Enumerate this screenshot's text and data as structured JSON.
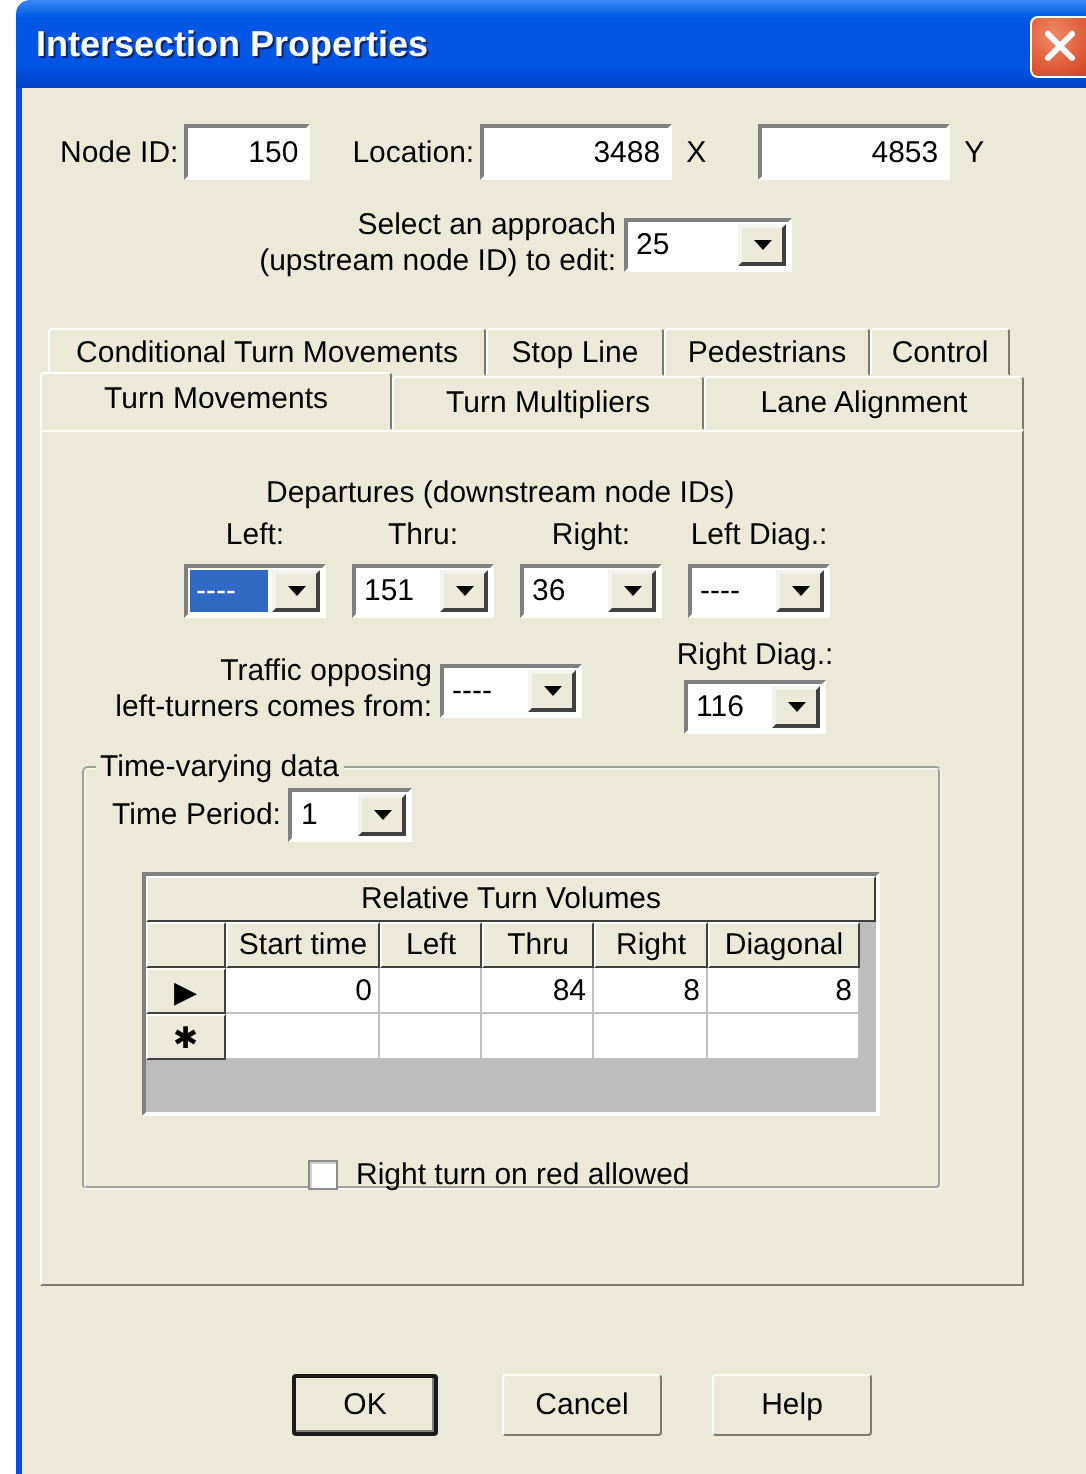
{
  "window": {
    "title": "Intersection Properties"
  },
  "node_id": {
    "label": "Node ID:",
    "value": "150"
  },
  "location": {
    "label": "Location:",
    "x": {
      "value": "3488",
      "unit": "X"
    },
    "y": {
      "value": "4853",
      "unit": "Y"
    }
  },
  "approach": {
    "label_lines": [
      "Select an approach",
      "(upstream node ID) to edit:"
    ],
    "value": "25"
  },
  "tab_rows": [
    [
      {
        "label": "Conditional Turn Movements",
        "selected": false
      },
      {
        "label": "Stop Line",
        "selected": false
      },
      {
        "label": "Pedestrians",
        "selected": false
      },
      {
        "label": "Control",
        "selected": false
      }
    ],
    [
      {
        "label": "Turn Movements",
        "selected": true
      },
      {
        "label": "Turn Multipliers",
        "selected": false
      },
      {
        "label": "Lane Alignment",
        "selected": false
      }
    ]
  ],
  "departures": {
    "title": "Departures (downstream node IDs)",
    "fields": [
      {
        "label": "Left:",
        "value": "----",
        "focused": true
      },
      {
        "label": "Thru:",
        "value": "151",
        "focused": false
      },
      {
        "label": "Right:",
        "value": "36",
        "focused": false
      },
      {
        "label": "Left Diag.:",
        "value": "----",
        "focused": false
      }
    ]
  },
  "opposing": {
    "label_lines": [
      "Traffic opposing",
      "left-turners comes from:"
    ],
    "value": "----"
  },
  "right_diag": {
    "label": "Right Diag.:",
    "value": "116"
  },
  "time_varying": {
    "title": "Time-varying data",
    "time_period": {
      "label": "Time Period:",
      "value": "1"
    },
    "table": {
      "title": "Relative Turn Volumes",
      "columns": [
        "Start time",
        "Left",
        "Thru",
        "Right",
        "Diagonal"
      ],
      "rows": [
        {
          "marker": "▶",
          "cells": [
            "0",
            null,
            "84",
            "8",
            "8"
          ]
        },
        {
          "marker": "✱",
          "cells": [
            null,
            null,
            null,
            null,
            null
          ]
        }
      ]
    },
    "right_turn_on_red": {
      "label": "Right turn on red allowed",
      "checked": false
    }
  },
  "buttons": [
    {
      "label": "OK",
      "default": true
    },
    {
      "label": "Cancel",
      "default": false
    },
    {
      "label": "Help",
      "default": false
    }
  ]
}
